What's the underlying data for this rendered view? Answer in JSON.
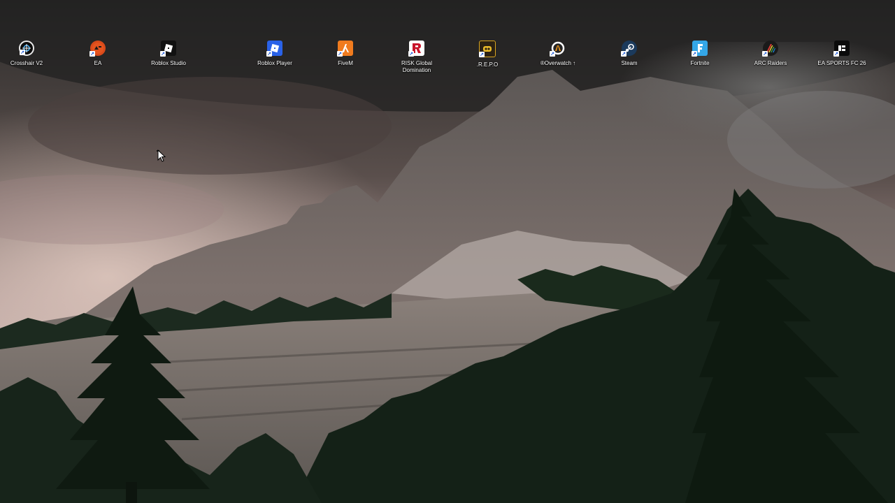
{
  "desktop": {
    "icons": [
      {
        "label": "Crosshair V2",
        "icon": "crosshair-icon",
        "color": "#0b0b0b"
      },
      {
        "label": "EA",
        "icon": "ea-icon",
        "color": "#d94a1a"
      },
      {
        "label": "Roblox Studio",
        "icon": "roblox-studio-icon",
        "color": "#111111"
      },
      {
        "label": "Roblox Player",
        "icon": "roblox-player-icon",
        "color": "#2a62e8"
      },
      {
        "label": "FiveM",
        "icon": "fivem-icon",
        "color": "#f07b1e"
      },
      {
        "label": "RISK Global Domination",
        "icon": "risk-icon",
        "color": "#c8142a"
      },
      {
        "label": ".R.E.P.O",
        "icon": "repo-icon",
        "color": "#2b2113"
      },
      {
        "label": "®Overwatch ↑",
        "icon": "overwatch-icon",
        "color": "#ffffff"
      },
      {
        "label": "Steam",
        "icon": "steam-icon",
        "color": "#1b3a5c"
      },
      {
        "label": "Fortnite",
        "icon": "fortnite-icon",
        "color": "#34a7e8"
      },
      {
        "label": "ARC Raiders",
        "icon": "arc-raiders-icon",
        "color": "#1a1a1a"
      },
      {
        "label": "EA SPORTS FC 26",
        "icon": "ea-sports-fc-icon",
        "color": "#0b0b0b"
      }
    ]
  }
}
